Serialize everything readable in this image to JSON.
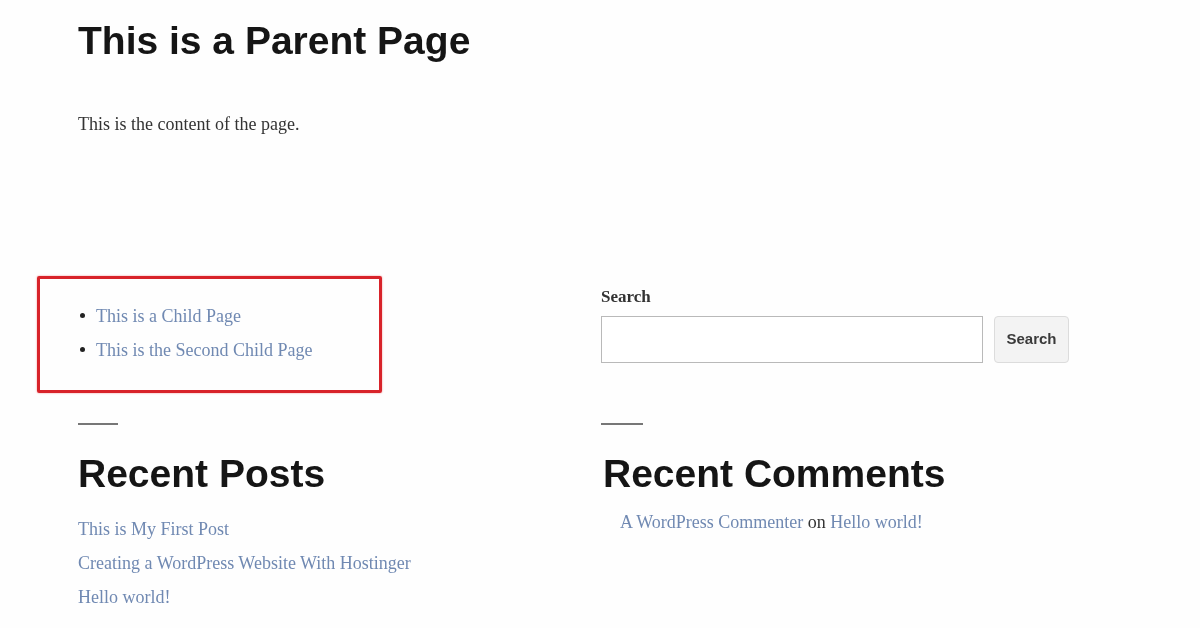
{
  "page": {
    "title": "This is a Parent Page",
    "content": "This is the content of the page."
  },
  "child_pages": {
    "highlighted": true,
    "items": [
      "This is a Child Page",
      "This is the Second Child Page"
    ]
  },
  "search_widget": {
    "label": "Search",
    "button": "Search"
  },
  "recent_posts": {
    "title": "Recent Posts",
    "items": [
      "This is My First Post",
      "Creating a WordPress Website With Hostinger",
      "Hello world!"
    ]
  },
  "recent_comments": {
    "title": "Recent Comments",
    "items": [
      {
        "author": "A WordPress Commenter",
        "connector": "on",
        "post": "Hello world!"
      }
    ]
  }
}
